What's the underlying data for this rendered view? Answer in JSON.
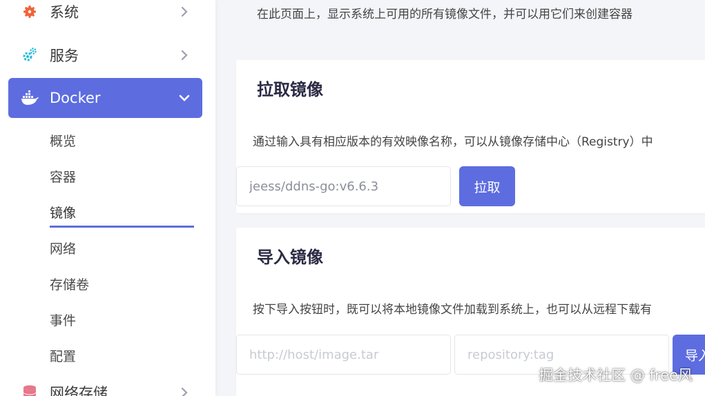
{
  "sidebar": {
    "items": [
      {
        "label": "系统",
        "icon": "gear-icon"
      },
      {
        "label": "服务",
        "icon": "services-icon"
      },
      {
        "label": "Docker",
        "icon": "docker-icon"
      },
      {
        "label": "网络存储",
        "icon": "storage-icon"
      }
    ],
    "docker_sub": [
      "概览",
      "容器",
      "镜像",
      "网络",
      "存储卷",
      "事件",
      "配置"
    ],
    "active_sub": "镜像"
  },
  "main": {
    "description": "在此页面上，显示系统上可用的所有镜像文件，并可以用它们来创建容器",
    "pull": {
      "title": "拉取镜像",
      "text": "通过输入具有相应版本的有效映像名称，可以从镜像存储中心（Registry）中",
      "input_value": "jeess/ddns-go:v6.6.3",
      "button": "拉取"
    },
    "import": {
      "title": "导入镜像",
      "text": "按下导入按钮时，既可以将本地镜像文件加载到系统上，也可以从远程下载有",
      "url_placeholder": "http://host/image.tar",
      "tag_placeholder": "repository:tag",
      "button": "导入"
    }
  },
  "watermark": "掘金技术社区 @ free风",
  "colors": {
    "accent": "#5d6de0",
    "gear": "#f0643a",
    "services": "#27b9d9",
    "storage": "#e8768a"
  }
}
